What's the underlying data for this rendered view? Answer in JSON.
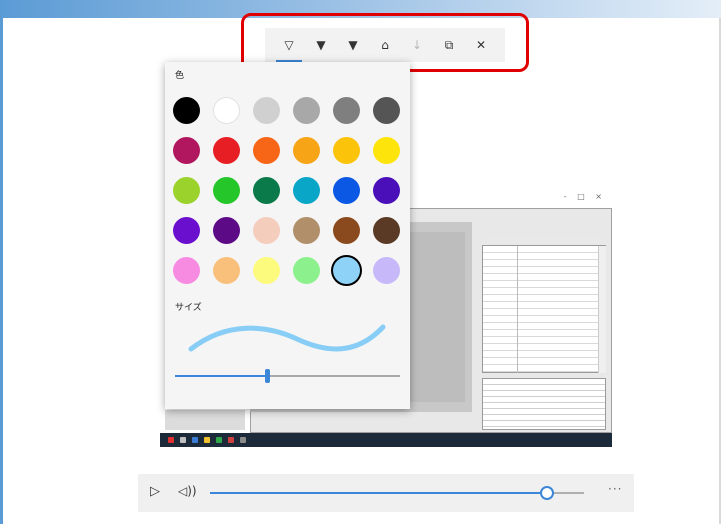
{
  "toolbar": {
    "tools": [
      {
        "name": "ballpoint-pen",
        "glyph": "▽",
        "active": true
      },
      {
        "name": "pencil",
        "glyph": "▼",
        "active": false
      },
      {
        "name": "highlighter",
        "glyph": "▼",
        "active": false
      },
      {
        "name": "eraser",
        "glyph": "⌂",
        "active": false
      },
      {
        "name": "ruler",
        "glyph": "↓",
        "active": false
      },
      {
        "name": "copy",
        "glyph": "⧉",
        "active": false
      },
      {
        "name": "close",
        "glyph": "✕",
        "active": false
      }
    ]
  },
  "flyout": {
    "color_label": "色",
    "size_label": "サイズ",
    "colors": [
      "#000000",
      "#ffffff",
      "#d0d0d0",
      "#a8a8a8",
      "#7f7f7f",
      "#555555",
      "#b0175e",
      "#e81e25",
      "#f76516",
      "#f7a417",
      "#fbc40a",
      "#fde40b",
      "#9bd22b",
      "#25c629",
      "#0a7a4a",
      "#0aa6c8",
      "#0a58e3",
      "#4a0fb8",
      "#6b0fcf",
      "#5c0a86",
      "#f4cdbd",
      "#b08f6a",
      "#8b4a1d",
      "#5a3a24",
      "#f78be2",
      "#f9c07c",
      "#fdfb7e",
      "#8cf18c",
      "#8ed2f7",
      "#c7b9f9"
    ],
    "selected_color_index": 28,
    "stroke_color": "#87cdf5",
    "size_level": 0.41
  },
  "media": {
    "play_glyph": "▷",
    "volume_glyph": "◁))",
    "more_glyph": "···",
    "progress": 0.9
  }
}
